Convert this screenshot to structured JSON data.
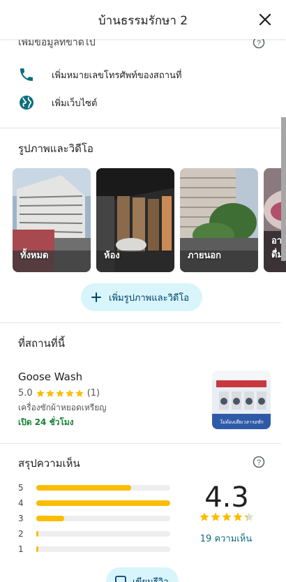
{
  "header": {
    "title": "บ้านธรรมรักษา 2"
  },
  "missing_info": {
    "title": "เพิ่มข้อมูลที่ขาดไป",
    "items": [
      {
        "label": "เพิ่มหมายเลขโทรศัพท์ของสถานที่",
        "icon": "phone-icon"
      },
      {
        "label": "เพิ่มเว็บไซต์",
        "icon": "globe-icon"
      }
    ]
  },
  "photos": {
    "title": "รูปภาพและวิดีโอ",
    "items": [
      {
        "label": "ทั้งหมด"
      },
      {
        "label": "ห้อง"
      },
      {
        "label": "ภายนอก"
      },
      {
        "label": "อาหาร & เครื่องดื่ม"
      }
    ],
    "add_button": "เพิ่มรูปภาพและวิดีโอ"
  },
  "nearby": {
    "title": "ที่สถานที่นี้",
    "place": {
      "name": "Goose Wash",
      "rating": "5.0",
      "stars": 5,
      "review_count": "(1)",
      "category": "เครื่องซักผ้าหยอดเหรียญ",
      "hours": "เปิด 24 ชั่วโมง",
      "thumb_text": "ไม่ต้องเสียเวลารอซัก"
    }
  },
  "reviews": {
    "title": "สรุปความเห็น",
    "distribution": [
      {
        "stars": "5",
        "fraction": 0.71
      },
      {
        "stars": "4",
        "fraction": 1.0
      },
      {
        "stars": "3",
        "fraction": 0.21
      },
      {
        "stars": "2",
        "fraction": 0.01
      },
      {
        "stars": "1",
        "fraction": 0.01
      }
    ],
    "average": "4.3",
    "average_stars": 4.3,
    "count_label": "19 ความเห็น",
    "write_button": "เขียนรีวิว"
  },
  "colors": {
    "star": "#fbbc04",
    "accent_teal": "#0b6e7c",
    "button_bg": "#d8f5fb",
    "open_green": "#188038"
  }
}
